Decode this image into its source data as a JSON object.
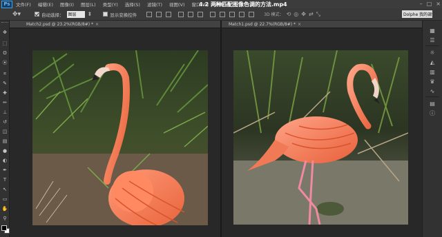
{
  "app": {
    "logo": "Ps"
  },
  "window": {
    "title": "4.2 两种匹配图像色调的方法.mp4"
  },
  "menu": {
    "items": [
      "文件(F)",
      "编辑(E)",
      "图像(I)",
      "图层(L)",
      "类型(Y)",
      "选择(S)",
      "滤镜(T)",
      "视图(V)",
      "窗口(W)",
      "帮助(H)"
    ]
  },
  "options": {
    "auto_select_label": "自动选择：",
    "auto_select_checked": true,
    "auto_select_value": "图层",
    "show_transform_label": "显示变换控件",
    "show_transform_checked": false,
    "mode_3d_label": "3D 模式：",
    "workspace": "Dolphe 我的调色"
  },
  "documents": [
    {
      "tab": "Match2.psd @ 23.2%(RGB/8#) *",
      "close": "×"
    },
    {
      "tab": "Match1.psd @ 22.7%(RGB/8#) *",
      "close": "×"
    }
  ],
  "toolbar": {
    "icons": [
      "move-icon",
      "marquee-icon",
      "lasso-icon",
      "quick-select-icon",
      "crop-icon",
      "eyedropper-icon",
      "healing-icon",
      "brush-icon",
      "stamp-icon",
      "history-brush-icon",
      "eraser-icon",
      "gradient-icon",
      "blur-icon",
      "dodge-icon",
      "pen-icon",
      "type-icon",
      "path-select-icon",
      "shape-icon",
      "hand-icon",
      "zoom-icon"
    ],
    "glyphs": [
      "✥",
      "⬚",
      "ʘ",
      "⦿",
      "⌗",
      "✎",
      "✚",
      "✏",
      "⊥",
      "↺",
      "◫",
      "▤",
      "●",
      "◐",
      "✒",
      "T",
      "↖",
      "▭",
      "✋",
      "⚲"
    ]
  },
  "panel": {
    "icons": [
      "grid-icon",
      "layers-icon",
      "sun-icon",
      "adjust-icon",
      "levels-icon",
      "crown-icon",
      "curves-icon",
      "gradient-panel-icon",
      "info-icon"
    ],
    "glyphs": [
      "▦",
      "☰",
      "☼",
      "◭",
      "▥",
      "♛",
      "∿",
      "▤",
      "ⓘ"
    ]
  },
  "colors": {
    "accent": "#31a8ff",
    "flamingo": "#f07a55",
    "foliage": "#3e5a2a"
  }
}
